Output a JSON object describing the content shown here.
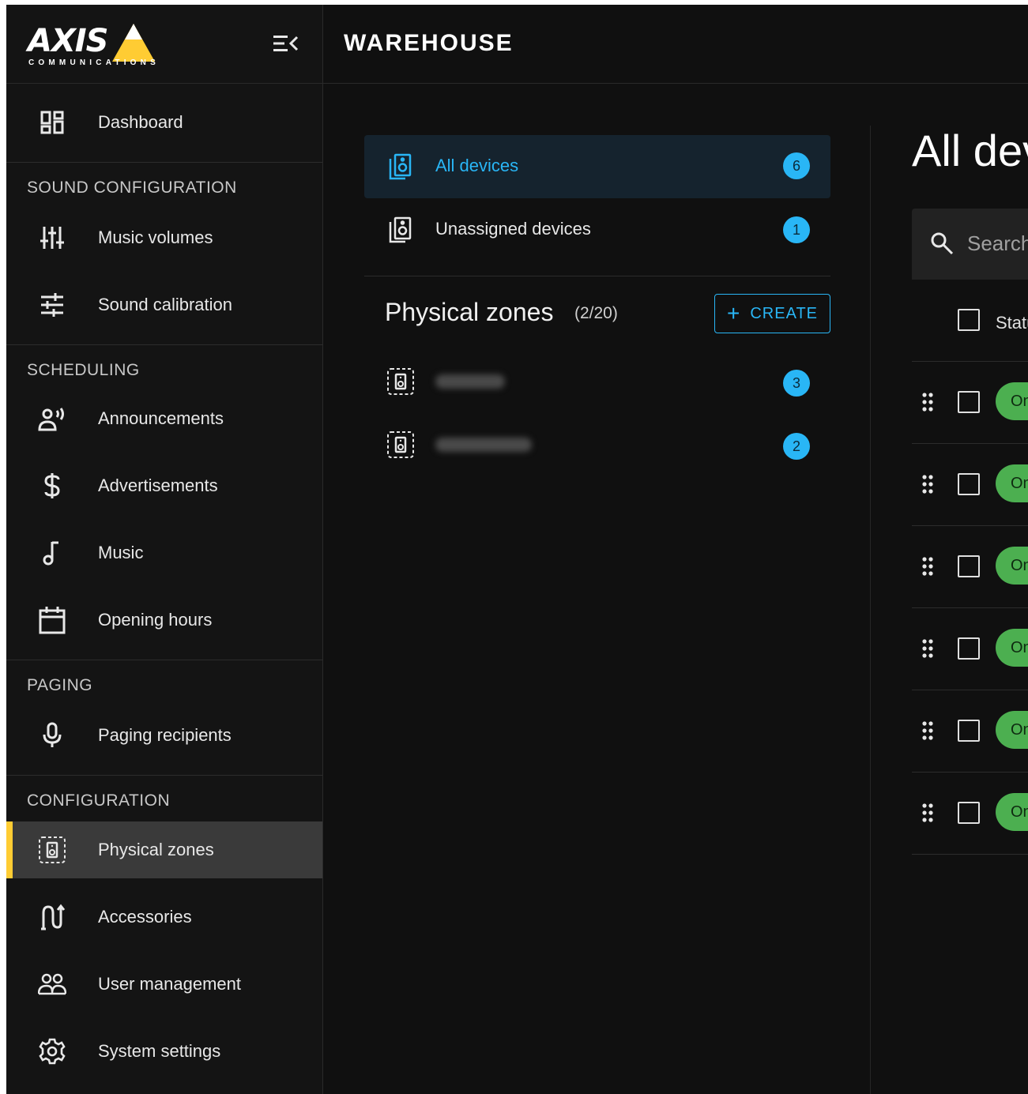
{
  "brand": {
    "logo_text": "AXIS",
    "logo_sub": "COMMUNICATIONS"
  },
  "header": {
    "site_title": "WAREHOUSE"
  },
  "sidebar": {
    "dashboard": "Dashboard",
    "sections": [
      {
        "title": "SOUND CONFIGURATION",
        "items": [
          "Music volumes",
          "Sound calibration"
        ]
      },
      {
        "title": "SCHEDULING",
        "items": [
          "Announcements",
          "Advertisements",
          "Music",
          "Opening hours"
        ]
      },
      {
        "title": "PAGING",
        "items": [
          "Paging recipients"
        ]
      },
      {
        "title": "CONFIGURATION",
        "items": [
          "Physical zones",
          "Accessories",
          "User management",
          "System settings"
        ]
      }
    ],
    "active_item": "Physical zones"
  },
  "zones_panel": {
    "all_devices": {
      "label": "All devices",
      "count": "6"
    },
    "unassigned": {
      "label": "Unassigned devices",
      "count": "1"
    },
    "physical_zones_title": "Physical zones",
    "physical_zones_count": "(2/20)",
    "create_label": "CREATE",
    "zones": [
      {
        "count": "3"
      },
      {
        "count": "2"
      }
    ]
  },
  "devices_panel": {
    "title": "All devices",
    "search_placeholder": "Search",
    "status_header": "Status",
    "rows": [
      {
        "status": "Online"
      },
      {
        "status": "Online"
      },
      {
        "status": "Online"
      },
      {
        "status": "Online"
      },
      {
        "status": "Online"
      },
      {
        "status": "Online"
      }
    ]
  },
  "colors": {
    "accent": "#29b6f6",
    "active_marker": "#ffcc33",
    "online": "#4caf50"
  }
}
